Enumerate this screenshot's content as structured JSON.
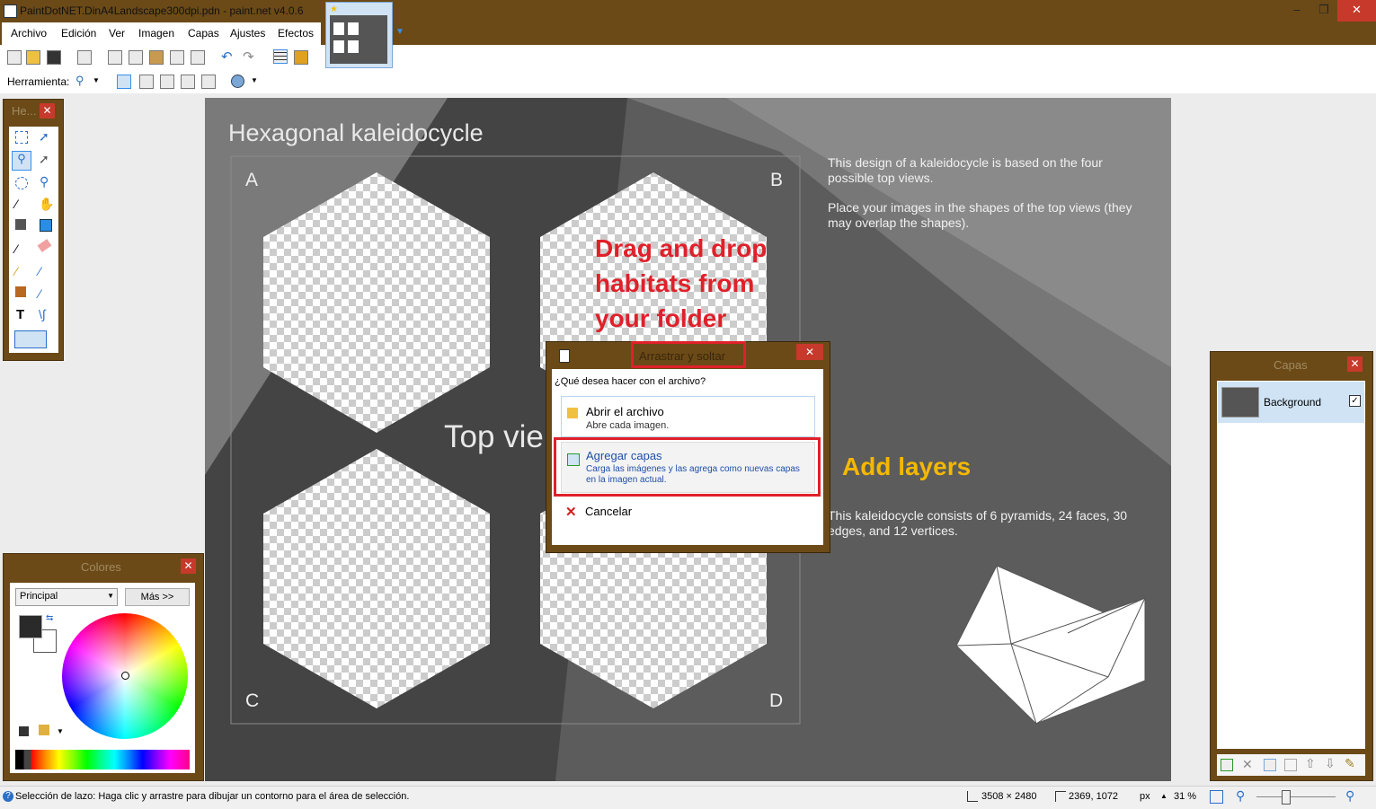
{
  "window": {
    "title": "PaintDotNET.DinA4Landscape300dpi.pdn - paint.net v4.0.6"
  },
  "menu": [
    "Archivo",
    "Edición",
    "Ver",
    "Imagen",
    "Capas",
    "Ajustes",
    "Efectos"
  ],
  "toolbar": {
    "tool_label": "Herramienta:"
  },
  "tools_panel": {
    "title": "He..."
  },
  "colors_panel": {
    "title": "Colores",
    "mode": "Principal",
    "more_button": "Más >>"
  },
  "layers_panel": {
    "title": "Capas",
    "layers": [
      {
        "name": "Background",
        "visible": true
      }
    ]
  },
  "canvas": {
    "heading": "Hexagonal kaleidocycle",
    "corner_labels": [
      "A",
      "B",
      "C",
      "D"
    ],
    "center_text": "Top vie",
    "desc1": "This design of a kaleidocycle is based on the four possible top views.",
    "desc2": "Place your images in the shapes of the top views (they may overlap the shapes).",
    "desc3": "This kaleidocycle consists of 6 pyramids, 24 faces, 30 edges, and 12 vertices.",
    "annotation_drag": "Drag and drop habitats from your folder",
    "annotation_add": "Add layers"
  },
  "dialog": {
    "title": "Arrastrar y soltar",
    "question": "¿Qué desea hacer con el archivo?",
    "options": [
      {
        "label": "Abrir el archivo",
        "desc": "Abre cada imagen."
      },
      {
        "label": "Agregar capas",
        "desc": "Carga las imágenes y las agrega como nuevas capas en la imagen actual."
      },
      {
        "label": "Cancelar",
        "desc": ""
      }
    ]
  },
  "status": {
    "hint": "Selección de lazo: Haga clic y arrastre para dibujar un contorno para el área de selección.",
    "image_size": "3508 × 2480",
    "cursor_pos": "2369, 1072",
    "units": "px",
    "zoom": "31 %"
  },
  "colors": {
    "accent_brown": "#6b4a18",
    "highlight_red": "#e0202a",
    "annotation_yellow": "#f5b800"
  }
}
